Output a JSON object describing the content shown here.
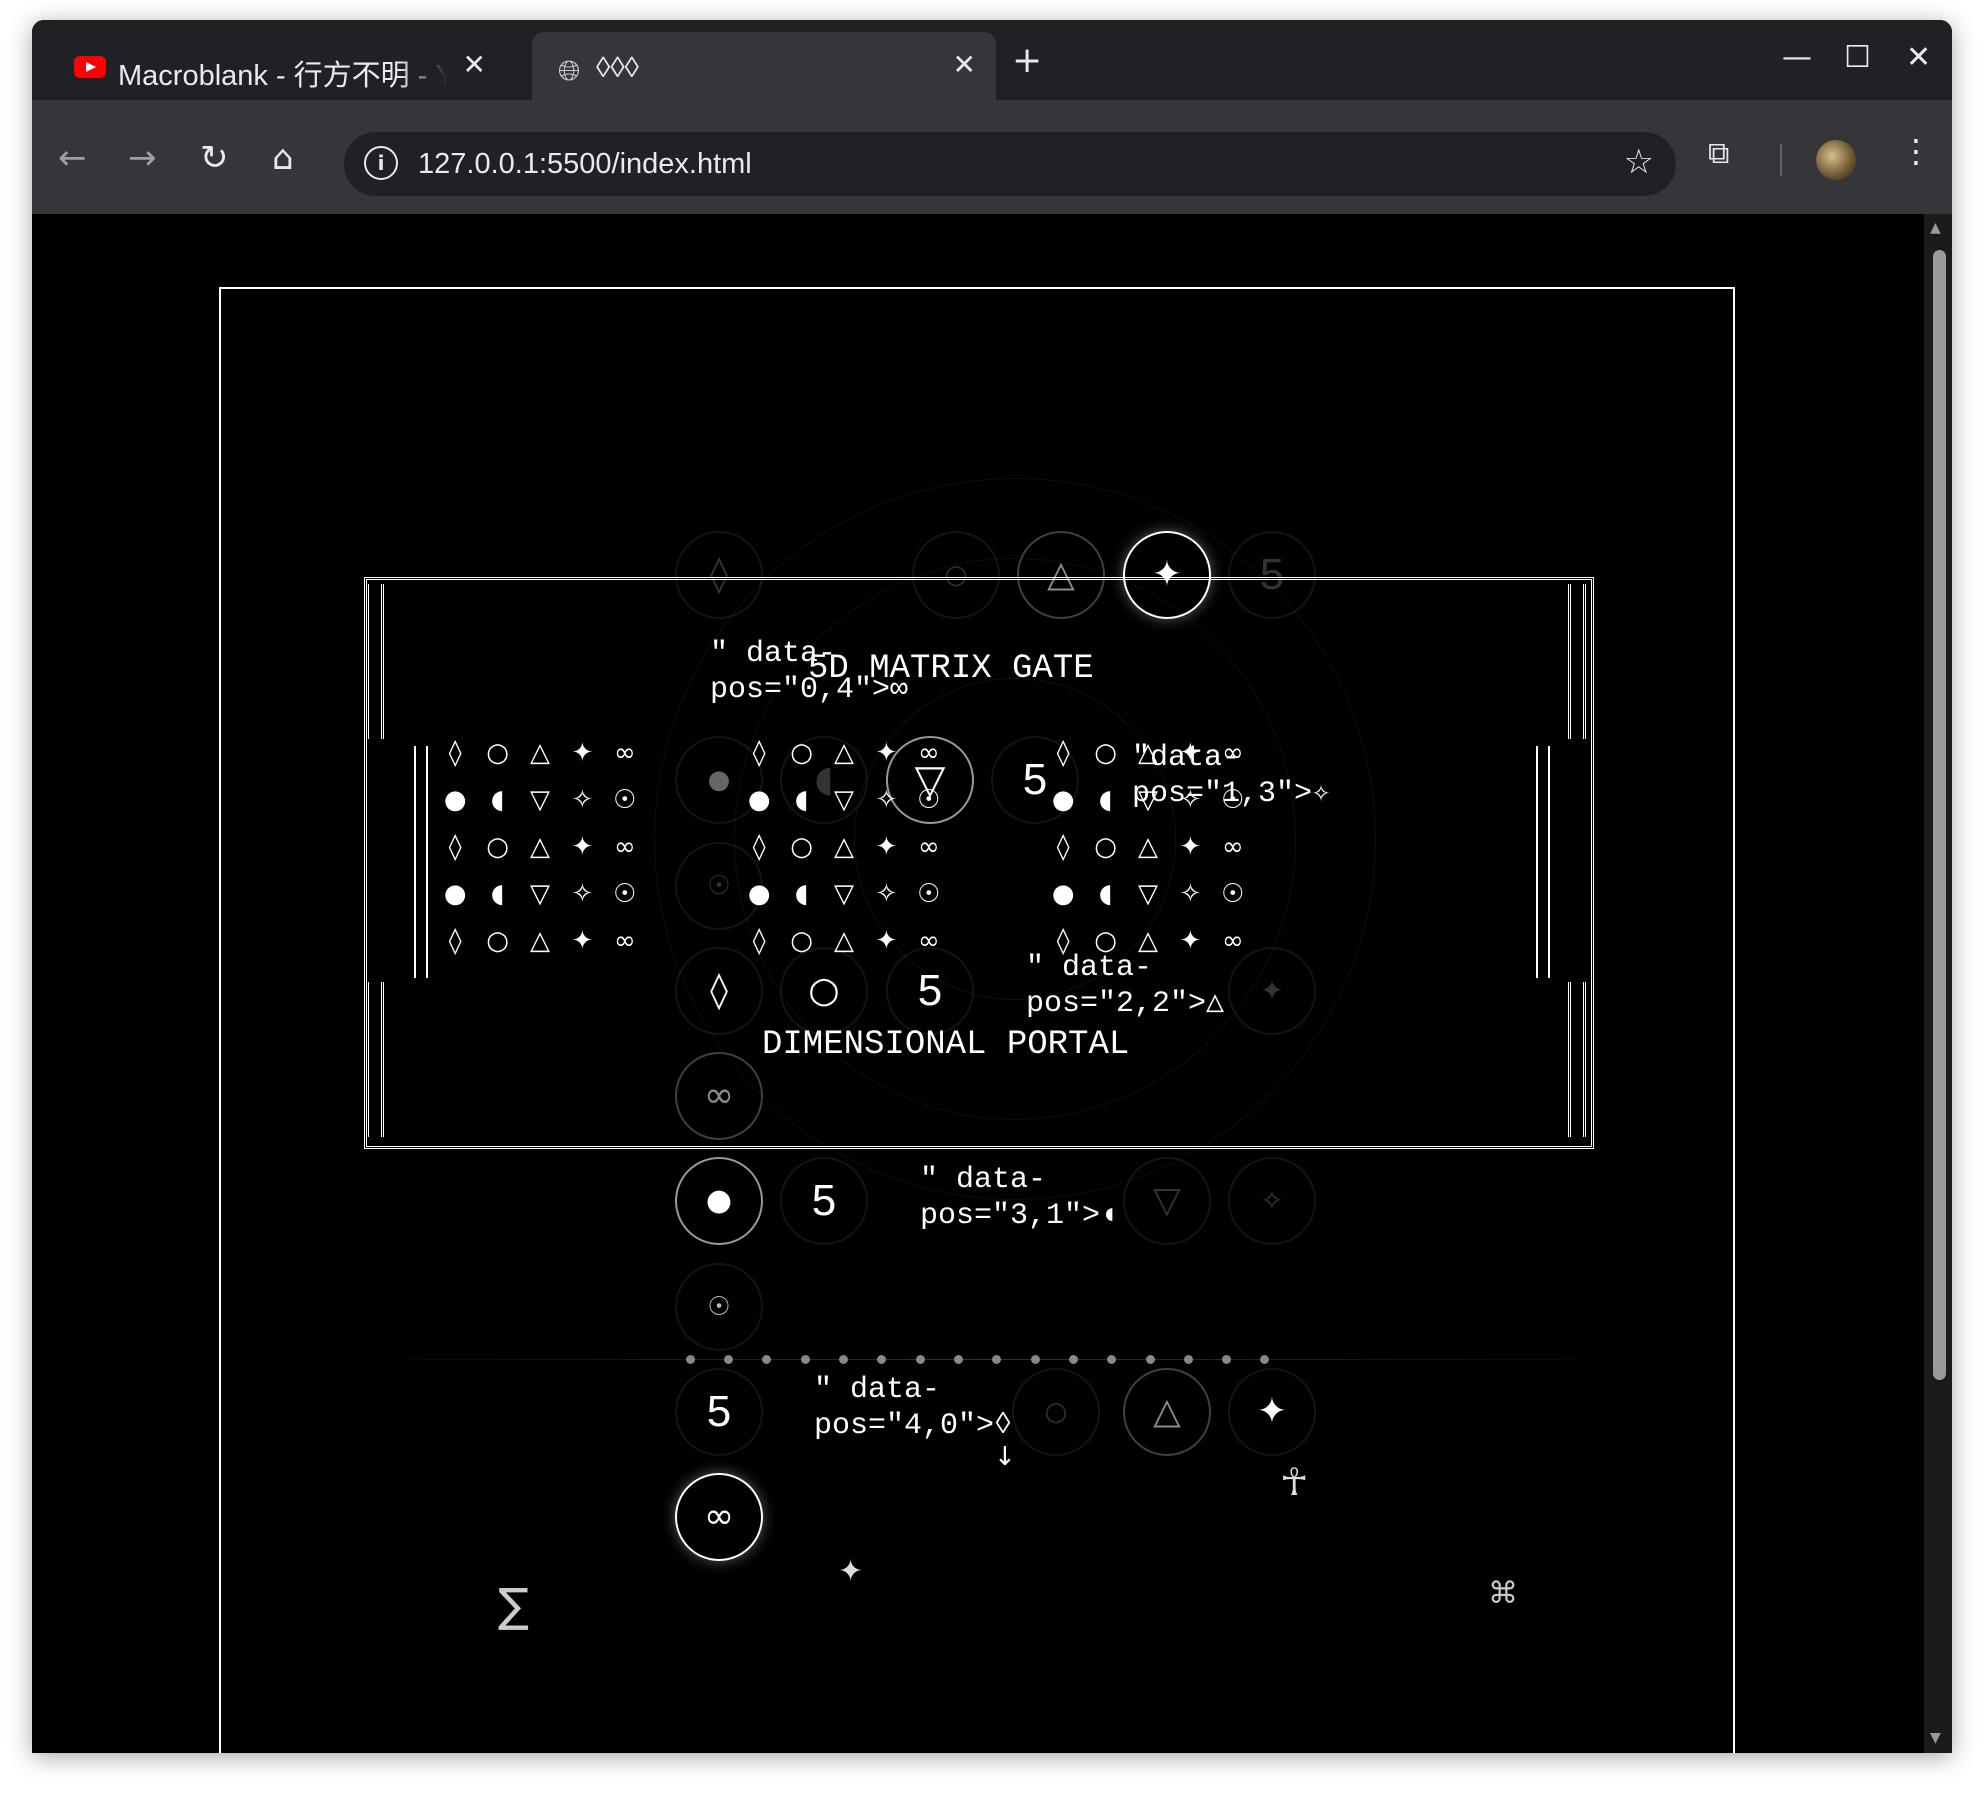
{
  "browser": {
    "tabs": [
      {
        "title": "Macroblank - 行方不明 - Y",
        "active": false,
        "icon": "youtube-icon"
      },
      {
        "title": "◊◊◊",
        "active": true,
        "icon": "globe-icon"
      }
    ],
    "new_tab": "+",
    "close_glyph": "✕",
    "window_controls": {
      "minimize": "—",
      "maximize": "☐",
      "close": "✕"
    },
    "nav": {
      "back": "←",
      "forward": "→",
      "reload": "↻",
      "home": "⌂"
    },
    "url": "127.0.0.1:5500/index.html",
    "bookmark_icon": "☆",
    "menu_icon": "⋮"
  },
  "page": {
    "top_title": "5D MATRIX GATE",
    "bottom_title": "DIMENSIONAL PORTAL",
    "fragments": {
      "f04": "\" data-\npos=\"0,4\">∞",
      "f13": "\"data-\npos=\"1,3\">✧",
      "f22": "\" data-\npos=\"2,2\">△",
      "f31": "\" data-\npos=\"3,1\">◖",
      "f40": "\" data-\npos=\"4,0\">◊"
    },
    "grid_rows": [
      [
        "◊",
        "○",
        "△",
        "✦",
        "∞"
      ],
      [
        "●",
        "◖",
        "▽",
        "✧",
        "☉"
      ],
      [
        "◊",
        "○",
        "△",
        "✦",
        "∞"
      ],
      [
        "●",
        "◖",
        "▽",
        "✧",
        "☉"
      ],
      [
        "◊",
        "○",
        "△",
        "✦",
        "∞"
      ]
    ],
    "cells": {
      "r0": [
        "◊",
        "○",
        "△",
        "✦",
        "5"
      ],
      "r1": [
        "●",
        "◖",
        "▽",
        "5"
      ],
      "r2": [
        "◊",
        "○",
        "5",
        "✦"
      ],
      "r3": [
        "●",
        "5",
        "▽",
        "✧"
      ],
      "r4": [
        "5",
        "○",
        "△",
        "✦"
      ],
      "extra_infinity_a": "∞",
      "extra_infinity_b": "∞",
      "extra_sun_a": "☉",
      "extra_sun_b": "☉"
    },
    "floaters": {
      "sigma": "∑",
      "ankh": "☥",
      "command": "⌘",
      "sparkle": "✦",
      "arrow": "↓"
    }
  }
}
